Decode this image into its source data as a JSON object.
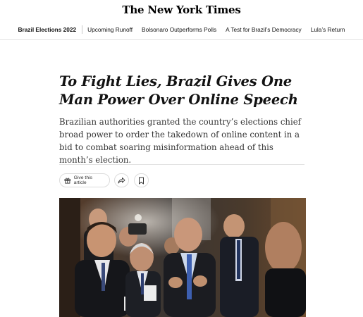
{
  "masthead": {
    "logo": "The New York Times"
  },
  "nav": {
    "section": "Brazil Elections 2022",
    "links": [
      "Upcoming Runoff",
      "Bolsonaro Outperforms Polls",
      "A Test for Brazil’s Democracy",
      "Lula’s Return"
    ]
  },
  "article": {
    "headline": "To Fight Lies, Brazil Gives One Man Power Over Online Speech",
    "summary": "Brazilian authorities granted the country’s elections chief broad power to order the takedown of online content in a bid to combat soaring misinformation ahead of this month’s election."
  },
  "actions": {
    "gift_label": "Give this article",
    "gift_icon": "gift-icon",
    "share_icon": "share-icon",
    "save_icon": "bookmark-icon"
  }
}
